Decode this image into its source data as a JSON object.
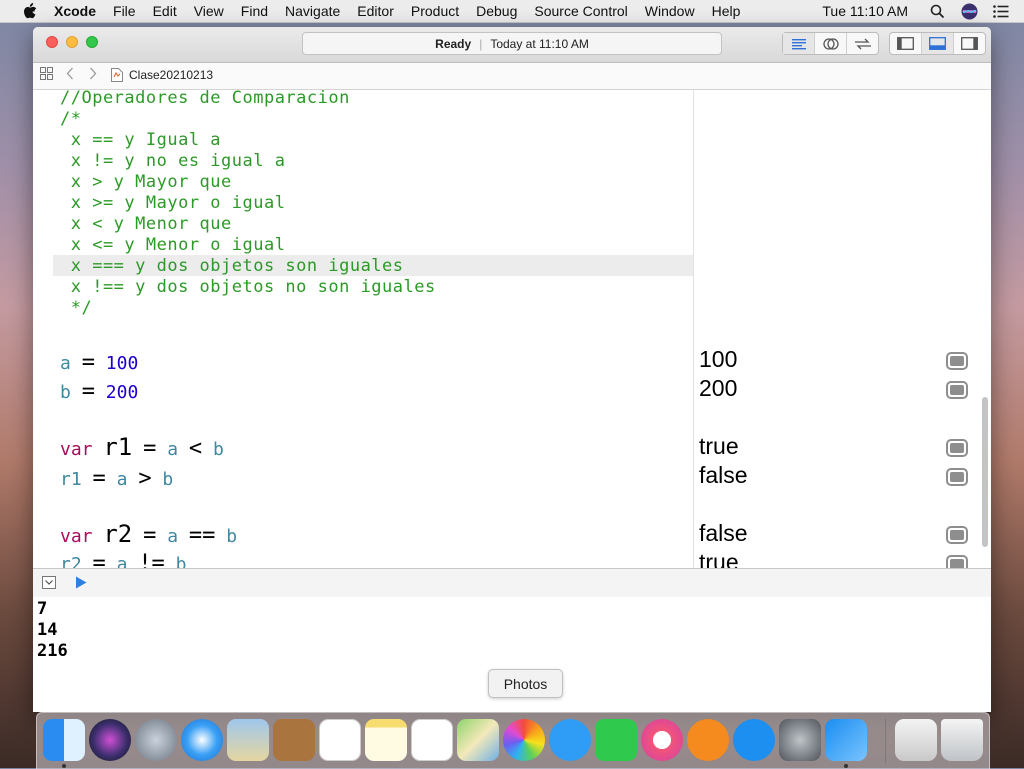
{
  "menubar": {
    "app_name": "Xcode",
    "items": [
      "File",
      "Edit",
      "View",
      "Find",
      "Navigate",
      "Editor",
      "Product",
      "Debug",
      "Source Control",
      "Window",
      "Help"
    ],
    "clock": "Tue 11:10 AM"
  },
  "window": {
    "status": "Ready",
    "status_time": "Today at 11:10 AM",
    "filename": "Clase20210213"
  },
  "code": {
    "comment_lines": [
      "//Operadores de Comparacion",
      "/*",
      " x == y Igual a",
      " x != y no es igual a",
      " x > y Mayor que",
      " x >= y Mayor o igual",
      " x < y Menor que",
      " x <= y Menor o igual",
      " x === y dos objetos son iguales",
      " x !== y dos objetos no son iguales",
      " */"
    ],
    "highlighted_line_index": 8,
    "stmt_a": {
      "name": "a",
      "eq": "=",
      "value": "100"
    },
    "stmt_b": {
      "name": "b",
      "eq": "=",
      "value": "200"
    },
    "stmt_r1": {
      "kw": "var",
      "name": "r1",
      "eq": "=",
      "lhs": "a",
      "op": "<",
      "rhs": "b"
    },
    "stmt_r1b": {
      "name": "r1",
      "eq": "=",
      "lhs": "a",
      "op": ">",
      "rhs": "b"
    },
    "stmt_r2": {
      "kw": "var",
      "name": "r2",
      "eq": "=",
      "lhs": "a",
      "op": "==",
      "rhs": "b"
    },
    "stmt_r2b": {
      "name": "r2",
      "eq": "=",
      "lhs": "a",
      "op": "!=",
      "rhs": "b"
    }
  },
  "results": [
    "100",
    "200",
    "true",
    "false",
    "false",
    "true"
  ],
  "console": [
    "7",
    "14",
    "216"
  ],
  "tooltip": "Photos",
  "colors": {
    "comment": "#2b9a26",
    "keyword": "#aa0d5c",
    "identifier": "#3d89a0",
    "number": "#1c00cf"
  }
}
